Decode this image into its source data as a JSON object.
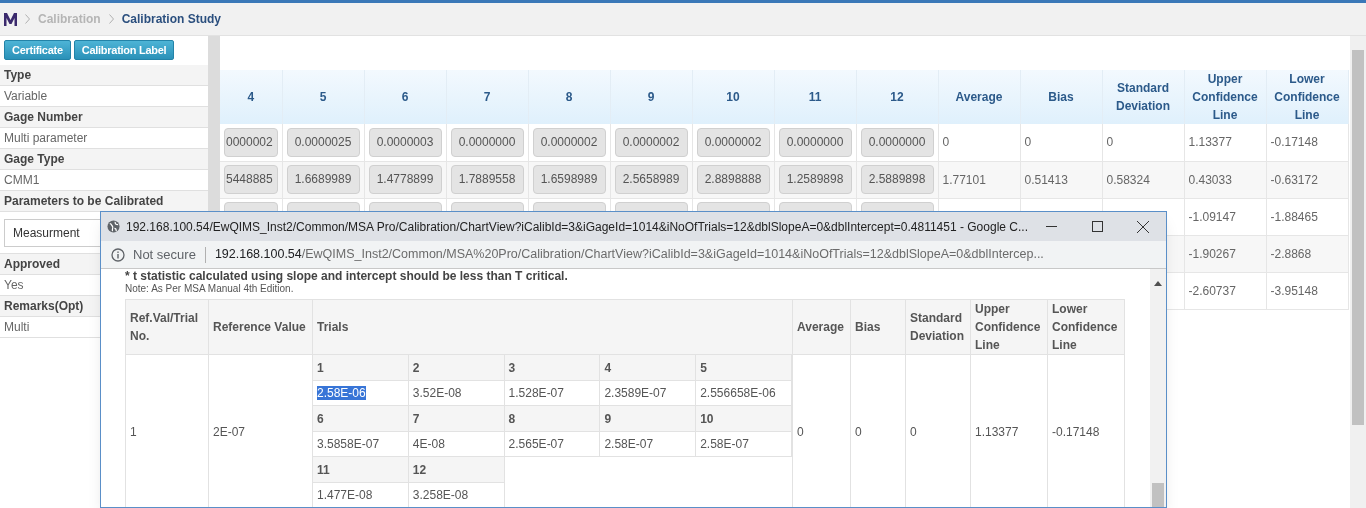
{
  "breadcrumb": [
    {
      "label": "Calibration",
      "current": false
    },
    {
      "label": "Calibration Study",
      "current": true
    }
  ],
  "buttons": [
    "Certificate",
    "Calibration Label"
  ],
  "fields": [
    {
      "label": "Type",
      "value": "Variable",
      "kind": "text"
    },
    {
      "label": "Gage Number",
      "value": "Multi parameter",
      "kind": "text"
    },
    {
      "label": "Gage Type",
      "value": "CMM1",
      "kind": "text"
    },
    {
      "label": "Parameters to be Calibrated",
      "value": "Measurment",
      "kind": "select"
    },
    {
      "label": "Approved",
      "value": "Yes",
      "kind": "text"
    },
    {
      "label": "Remarks(Opt)",
      "value": "Multi",
      "kind": "text"
    }
  ],
  "table": {
    "columns": [
      "4",
      "5",
      "6",
      "7",
      "8",
      "9",
      "10",
      "11",
      "12",
      "Average",
      "Bias",
      "Standard Deviation",
      "Upper Confidence Line",
      "Lower Confidence Line"
    ],
    "rows": [
      {
        "trials": [
          "0000002",
          "0.0000025",
          "0.0000003",
          "0.0000000",
          "0.0000002",
          "0.0000002",
          "0.0000002",
          "0.0000000",
          "0.0000000"
        ],
        "average": "0",
        "bias": "0",
        "std_dev": "0",
        "upper": "1.13377",
        "lower": "-0.17148"
      },
      {
        "trials": [
          "5448885",
          "1.6689989",
          "1.4778899",
          "1.7889558",
          "1.6598989",
          "2.5658989",
          "2.8898888",
          "1.2589898",
          "2.5889898"
        ],
        "average": "1.77101",
        "bias": "0.51413",
        "std_dev": "0.58324",
        "upper": "0.43033",
        "lower": "-0.63172"
      },
      {
        "upper": "-1.09147",
        "lower": "-1.88465"
      },
      {
        "upper": "-1.90267",
        "lower": "-2.8868"
      },
      {
        "upper": "-2.60737",
        "lower": "-3.95148"
      }
    ]
  },
  "popup": {
    "title": "192.168.100.54/EwQIMS_Inst2/Common/MSA Pro/Calibration/ChartView?iCalibId=3&iGageId=1014&iNoOfTrials=12&dblSlopeA=0&dblIntercept=0.4811451 - Google C...",
    "security": "Not secure",
    "url_host": "192.168.100.54",
    "url_path": "/EwQIMS_Inst2/Common/MSA%20Pro/Calibration/ChartView?iCalibId=3&iGageId=1014&iNoOfTrials=12&dblSlopeA=0&dblIntercep...",
    "notice": "* t statistic calculated using slope and intercept should be less than T critical.",
    "note": "Note: As Per MSA Manual 4th Edition.",
    "columns": [
      "Ref.Val/Trial No.",
      "Reference Value",
      "Trials",
      "Average",
      "Bias",
      "Standard Deviation",
      "Upper Confidence Line",
      "Lower Confidence Line"
    ],
    "row": {
      "number": "1",
      "reference": "2E-07",
      "average": "0",
      "bias": "0",
      "std_dev": "0",
      "upper": "1.13377",
      "lower": "-0.17148",
      "trials": [
        {
          "label": "1",
          "value": "2.58E-06",
          "highlighted": true
        },
        {
          "label": "2",
          "value": "3.52E-08",
          "highlighted": false
        },
        {
          "label": "3",
          "value": "1.528E-07",
          "highlighted": false
        },
        {
          "label": "4",
          "value": "2.3589E-07",
          "highlighted": false
        },
        {
          "label": "5",
          "value": "2.556658E-06",
          "highlighted": false
        },
        {
          "label": "6",
          "value": "3.5858E-07",
          "highlighted": false
        },
        {
          "label": "7",
          "value": "4E-08",
          "highlighted": false
        },
        {
          "label": "8",
          "value": "2.565E-07",
          "highlighted": false
        },
        {
          "label": "9",
          "value": "2.58E-07",
          "highlighted": false
        },
        {
          "label": "10",
          "value": "2.58E-07",
          "highlighted": false
        },
        {
          "label": "11",
          "value": "1.477E-08",
          "highlighted": false
        },
        {
          "label": "12",
          "value": "3.258E-08",
          "highlighted": false
        }
      ]
    }
  }
}
